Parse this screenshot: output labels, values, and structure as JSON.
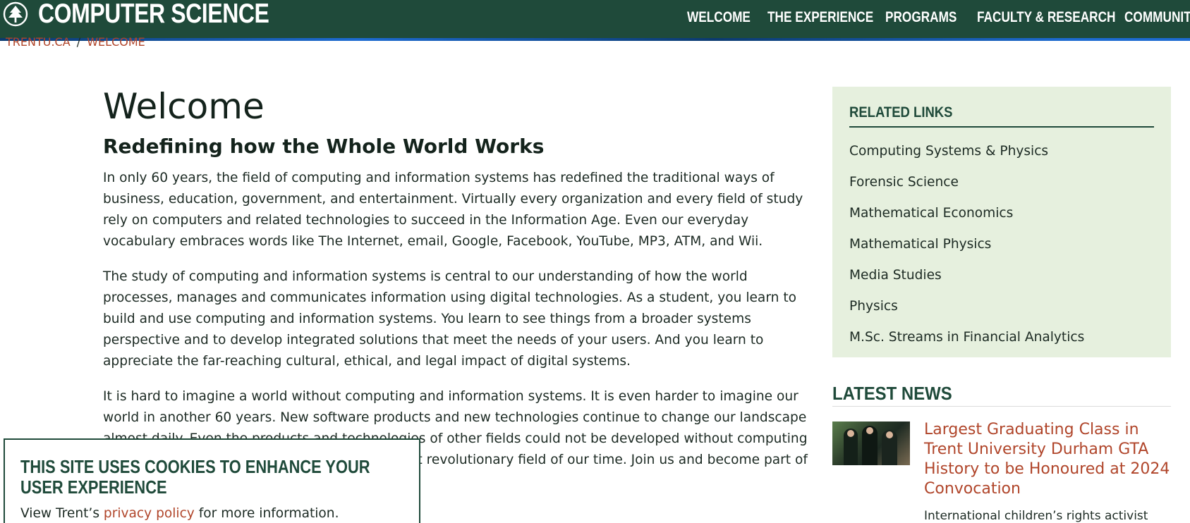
{
  "header": {
    "site_title": "COMPUTER SCIENCE",
    "nav": [
      "WELCOME",
      "THE EXPERIENCE",
      "PROGRAMS",
      "FACULTY & RESEARCH",
      "COMMUNITY"
    ]
  },
  "breadcrumb": {
    "home": "TRENTU.CA",
    "separator": "/",
    "current": "WELCOME"
  },
  "main": {
    "title": "Welcome",
    "subtitle": "Redefining how the Whole World Works",
    "paragraphs": [
      "In only 60 years, the field of computing and information systems has redefined the traditional ways of business, education, government, and entertainment.  Virtually every organization and every field of study rely on computers and related technologies to succeed in the Information Age.  Even our everyday vocabulary embraces words like The Internet, email, Google, Facebook, YouTube, MP3, ATM, and Wii.",
      "The study of computing and information systems is central to our understanding of how the world processes, manages and communicates information using digital technologies.  As a student, you learn to build and use computing and information systems.  You learn to see things from a broader systems perspective and to develop integrated solutions that meet the needs of your users.  And you learn to appreciate the far-reaching cultural, ethical, and legal impact of digital systems.",
      "It is hard to imagine a world without computing and information systems.  It is even harder to imagine our world in another 60 years.  New software products and new technologies continue to change our landscape almost daily.  Even the products and technologies of other fields could not be developed without computing and information systems.  It is arguably the most revolutionary field of our time.  Join us and become part of our adventure."
    ]
  },
  "sidebar": {
    "related_title": "RELATED LINKS",
    "related_links": [
      "Computing Systems & Physics",
      "Forensic Science",
      "Mathematical Economics",
      "Mathematical Physics",
      "Media Studies",
      "Physics",
      "M.Sc. Streams in Financial Analytics"
    ],
    "news_title": "LATEST NEWS",
    "news_headline": "Largest Graduating Class in Trent University Durham GTA History to be Honoured at 2024 Convocation",
    "news_excerpt": "International children’s rights activist"
  },
  "cookie": {
    "title": "THIS SITE USES COOKIES TO ENHANCE YOUR USER EXPERIENCE",
    "text_before": "View Trent’s ",
    "link": "privacy policy",
    "text_after": " for more information."
  },
  "colors": {
    "header_bg": "#1f4a3a",
    "accent_link": "#b0452a",
    "sidebar_bg": "#e6f0de"
  }
}
